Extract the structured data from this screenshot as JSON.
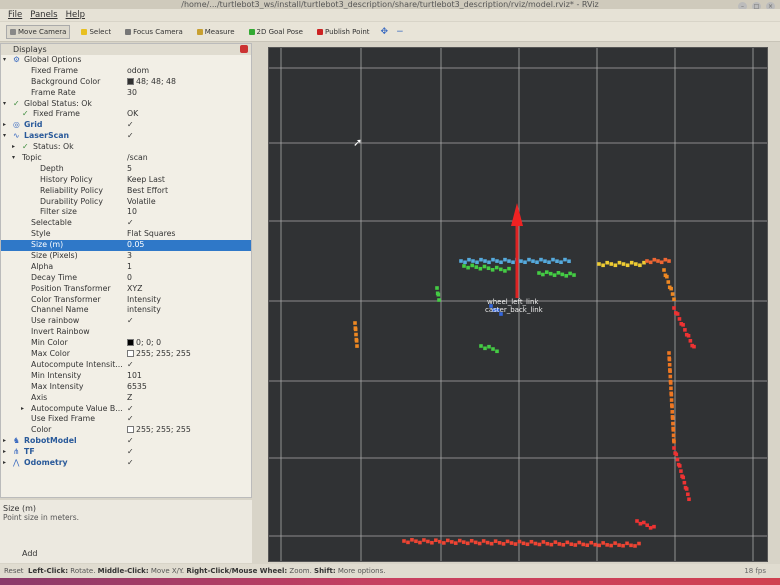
{
  "window": {
    "title": "/home/.../turtlebot3_ws/install/turtlebot3_description/share/turtlebot3_description/rviz/model.rviz* - RViz"
  },
  "menu": [
    "File",
    "Panels",
    "Help"
  ],
  "toolbar": {
    "tools": [
      {
        "label": "Move Camera",
        "icon": "camera-icon"
      },
      {
        "label": "Select",
        "icon": "select-icon"
      },
      {
        "label": "Focus Camera",
        "icon": "focus-icon"
      },
      {
        "label": "Measure",
        "icon": "ruler-icon"
      },
      {
        "label": "2D Goal Pose",
        "icon": "arrow-icon"
      },
      {
        "label": "Publish Point",
        "icon": "pin-icon"
      }
    ]
  },
  "displays": {
    "title": "Displays",
    "rows": [
      {
        "k": "Global Options",
        "v": "",
        "indent": 0,
        "exp": "▾",
        "icon": "⚙",
        "cls": ""
      },
      {
        "k": "Fixed Frame",
        "v": "odom",
        "indent": 2
      },
      {
        "k": "Background Color",
        "v": "48; 48; 48",
        "indent": 2,
        "swatch": "#303030"
      },
      {
        "k": "Frame Rate",
        "v": "30",
        "indent": 2
      },
      {
        "k": "Global Status: Ok",
        "v": "",
        "indent": 0,
        "exp": "▾",
        "icon": "✓"
      },
      {
        "k": "Fixed Frame",
        "v": "OK",
        "indent": 1,
        "icon": "✓"
      },
      {
        "k": "Grid",
        "v": "✓",
        "indent": 0,
        "exp": "▸",
        "icon": "◎",
        "cls": "blue"
      },
      {
        "k": "LaserScan",
        "v": "✓",
        "indent": 0,
        "exp": "▾",
        "icon": "∿",
        "cls": "blue"
      },
      {
        "k": "Status: Ok",
        "v": "",
        "indent": 1,
        "exp": "▸",
        "icon": "✓"
      },
      {
        "k": "Topic",
        "v": "/scan",
        "indent": 1,
        "exp": "▾"
      },
      {
        "k": "Depth",
        "v": "5",
        "indent": 3
      },
      {
        "k": "History Policy",
        "v": "Keep Last",
        "indent": 3
      },
      {
        "k": "Reliability Policy",
        "v": "Best Effort",
        "indent": 3
      },
      {
        "k": "Durability Policy",
        "v": "Volatile",
        "indent": 3
      },
      {
        "k": "Filter size",
        "v": "10",
        "indent": 3
      },
      {
        "k": "Selectable",
        "v": "✓",
        "indent": 2
      },
      {
        "k": "Style",
        "v": "Flat Squares",
        "indent": 2
      },
      {
        "k": "Size (m)",
        "v": "0.05",
        "indent": 2,
        "selected": true
      },
      {
        "k": "Size (Pixels)",
        "v": "3",
        "indent": 2
      },
      {
        "k": "Alpha",
        "v": "1",
        "indent": 2
      },
      {
        "k": "Decay Time",
        "v": "0",
        "indent": 2
      },
      {
        "k": "Position Transformer",
        "v": "XYZ",
        "indent": 2
      },
      {
        "k": "Color Transformer",
        "v": "Intensity",
        "indent": 2
      },
      {
        "k": "Channel Name",
        "v": "intensity",
        "indent": 2
      },
      {
        "k": "Use rainbow",
        "v": "✓",
        "indent": 2
      },
      {
        "k": "Invert Rainbow",
        "v": "",
        "indent": 2
      },
      {
        "k": "Min Color",
        "v": "0; 0; 0",
        "indent": 2,
        "swatch": "#000000"
      },
      {
        "k": "Max Color",
        "v": "255; 255; 255",
        "indent": 2,
        "swatch": "#ffffff"
      },
      {
        "k": "Autocompute Intensit...",
        "v": "✓",
        "indent": 2
      },
      {
        "k": "Min Intensity",
        "v": "101",
        "indent": 2
      },
      {
        "k": "Max Intensity",
        "v": "6535",
        "indent": 2
      },
      {
        "k": "Axis",
        "v": "Z",
        "indent": 2
      },
      {
        "k": "Autocompute Value B...",
        "v": "✓",
        "indent": 2,
        "exp": "▸"
      },
      {
        "k": "Use Fixed Frame",
        "v": "✓",
        "indent": 2
      },
      {
        "k": "Color",
        "v": "255; 255; 255",
        "indent": 2,
        "swatch": "#ffffff"
      },
      {
        "k": "RobotModel",
        "v": "✓",
        "indent": 0,
        "exp": "▸",
        "icon": "♞",
        "cls": "blue"
      },
      {
        "k": "TF",
        "v": "✓",
        "indent": 0,
        "exp": "▸",
        "icon": "⋔",
        "cls": "blue"
      },
      {
        "k": "Odometry",
        "v": "✓",
        "indent": 0,
        "exp": "▸",
        "icon": "⋀",
        "cls": "blue"
      }
    ]
  },
  "help": {
    "title": "Size (m)",
    "text": "Point size in meters."
  },
  "add_label": "Add",
  "viewport": {
    "frame_labels": [
      "wheel_left_link",
      "caster_back_link"
    ]
  },
  "status": {
    "reset": "Reset",
    "parts": [
      [
        "Left-Click:",
        " Rotate. "
      ],
      [
        "Middle-Click:",
        " Move X/Y. "
      ],
      [
        "Right-Click/Mouse Wheel:",
        " Zoom. "
      ],
      [
        "Shift:",
        " More options."
      ]
    ],
    "fps": "18 fps"
  }
}
